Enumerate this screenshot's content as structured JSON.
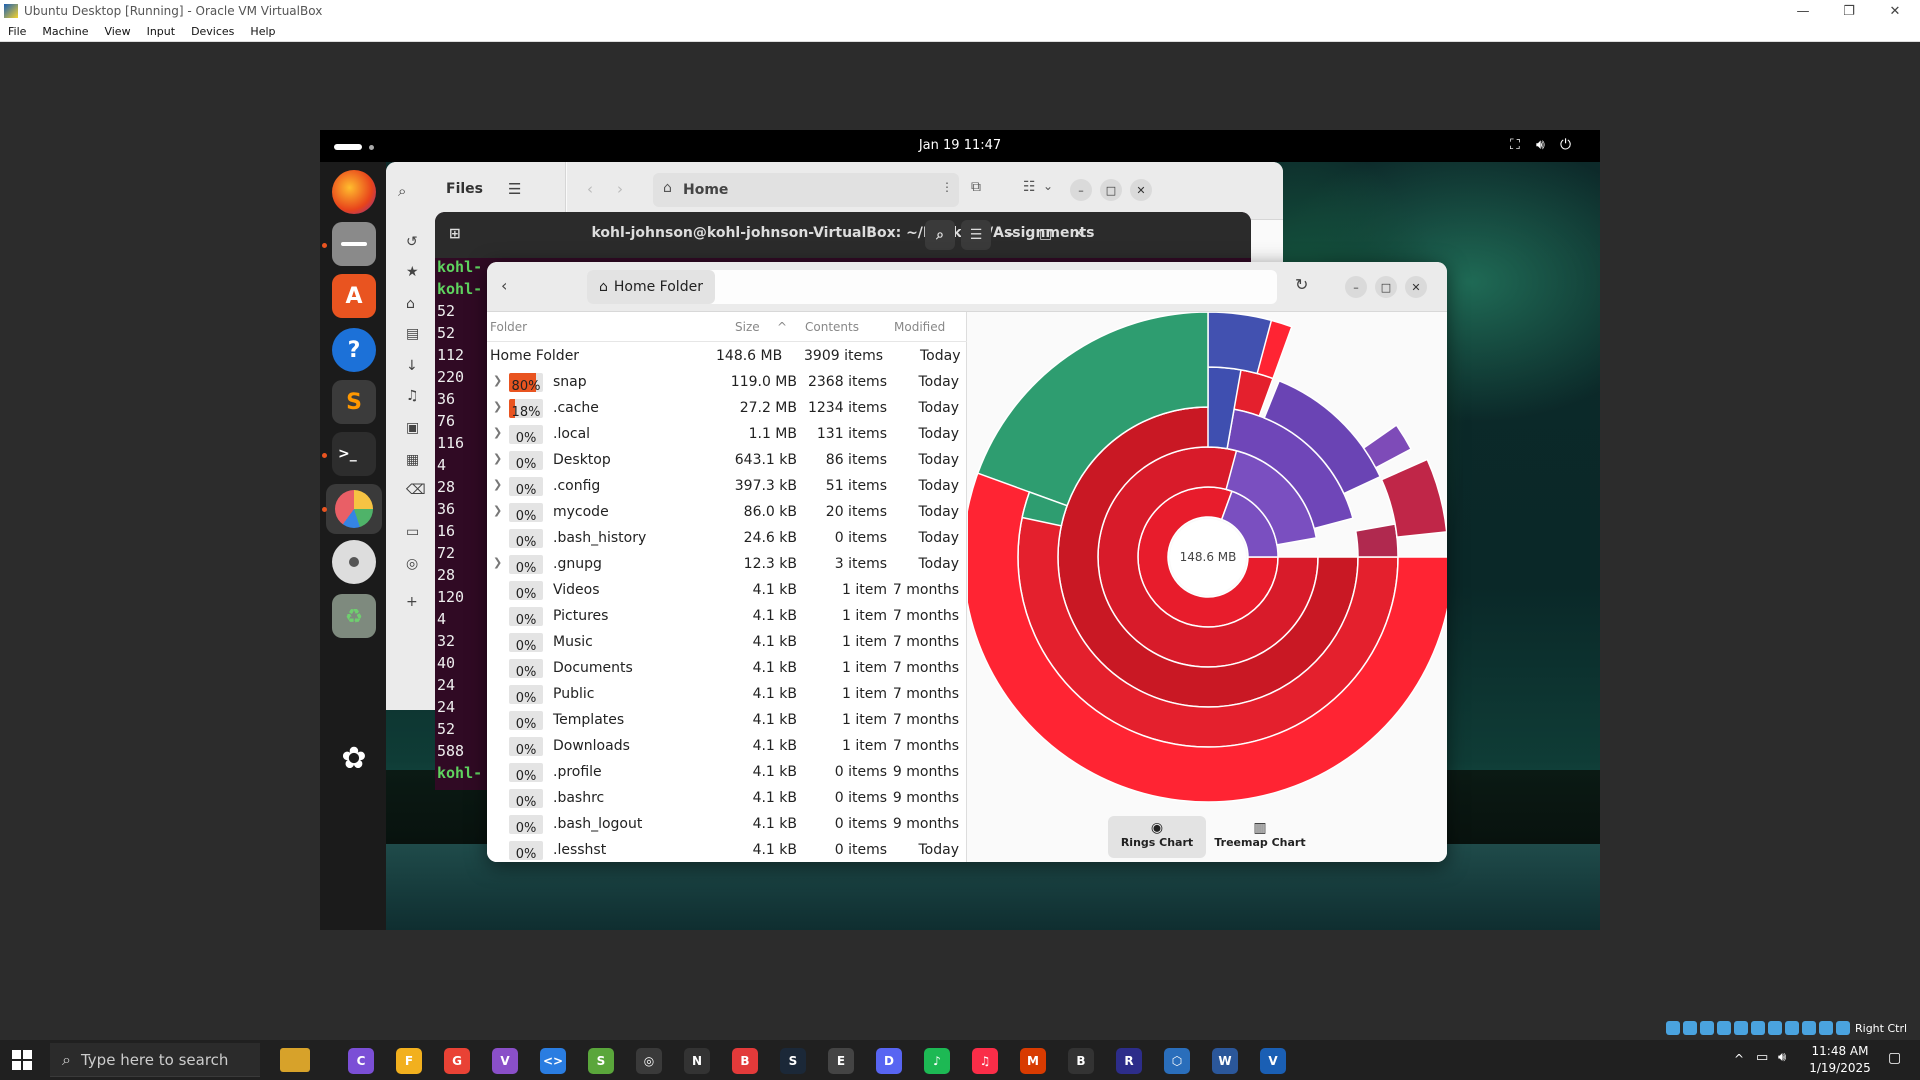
{
  "host": {
    "title": "Ubuntu Desktop [Running] - Oracle VM VirtualBox",
    "menu": [
      "File",
      "Machine",
      "View",
      "Input",
      "Devices",
      "Help"
    ],
    "host_key": "Right Ctrl"
  },
  "gnome": {
    "clock": "Jan 19  11:47"
  },
  "files_window": {
    "title": "Files",
    "location": "Home"
  },
  "terminal": {
    "title": "kohl-johnson@kohl-johnson-VirtualBox: ~/Desktop/Assignments",
    "prompt_fragment": "kohl-",
    "lines": [
      "kohl-",
      "kohl-",
      "52",
      "52",
      "112",
      "220",
      "36",
      "76",
      "116",
      "4",
      "28",
      "36",
      "16",
      "72",
      "28",
      "120",
      "4",
      "32",
      "40",
      "24",
      "24",
      "52",
      "588",
      "kohl-"
    ]
  },
  "baobab": {
    "location": "Home Folder",
    "columns": {
      "folder": "Folder",
      "size": "Size",
      "contents": "Contents",
      "modified": "Modified"
    },
    "root": {
      "name": "Home Folder",
      "size": "148.6 MB",
      "contents": "3909 items",
      "modified": "Today"
    },
    "rows": [
      {
        "pct": "80%",
        "fill": 80,
        "expand": true,
        "name": "snap",
        "size": "119.0 MB",
        "contents": "2368 items",
        "modified": "Today"
      },
      {
        "pct": "18%",
        "fill": 18,
        "expand": true,
        "name": ".cache",
        "size": "27.2 MB",
        "contents": "1234 items",
        "modified": "Today"
      },
      {
        "pct": "0%",
        "fill": 0,
        "expand": true,
        "name": ".local",
        "size": "1.1 MB",
        "contents": "131 items",
        "modified": "Today"
      },
      {
        "pct": "0%",
        "fill": 0,
        "expand": true,
        "name": "Desktop",
        "size": "643.1 kB",
        "contents": "86 items",
        "modified": "Today"
      },
      {
        "pct": "0%",
        "fill": 0,
        "expand": true,
        "name": ".config",
        "size": "397.3 kB",
        "contents": "51 items",
        "modified": "Today"
      },
      {
        "pct": "0%",
        "fill": 0,
        "expand": true,
        "name": "mycode",
        "size": "86.0 kB",
        "contents": "20 items",
        "modified": "Today"
      },
      {
        "pct": "0%",
        "fill": 0,
        "expand": false,
        "name": ".bash_history",
        "size": "24.6 kB",
        "contents": "0 items",
        "modified": "Today"
      },
      {
        "pct": "0%",
        "fill": 0,
        "expand": true,
        "name": ".gnupg",
        "size": "12.3 kB",
        "contents": "3 items",
        "modified": "Today"
      },
      {
        "pct": "0%",
        "fill": 0,
        "expand": false,
        "name": "Videos",
        "size": "4.1 kB",
        "contents": "1 item",
        "modified": "7 months"
      },
      {
        "pct": "0%",
        "fill": 0,
        "expand": false,
        "name": "Pictures",
        "size": "4.1 kB",
        "contents": "1 item",
        "modified": "7 months"
      },
      {
        "pct": "0%",
        "fill": 0,
        "expand": false,
        "name": "Music",
        "size": "4.1 kB",
        "contents": "1 item",
        "modified": "7 months"
      },
      {
        "pct": "0%",
        "fill": 0,
        "expand": false,
        "name": "Documents",
        "size": "4.1 kB",
        "contents": "1 item",
        "modified": "7 months"
      },
      {
        "pct": "0%",
        "fill": 0,
        "expand": false,
        "name": "Public",
        "size": "4.1 kB",
        "contents": "1 item",
        "modified": "7 months"
      },
      {
        "pct": "0%",
        "fill": 0,
        "expand": false,
        "name": "Templates",
        "size": "4.1 kB",
        "contents": "1 item",
        "modified": "7 months"
      },
      {
        "pct": "0%",
        "fill": 0,
        "expand": false,
        "name": "Downloads",
        "size": "4.1 kB",
        "contents": "1 item",
        "modified": "7 months"
      },
      {
        "pct": "0%",
        "fill": 0,
        "expand": false,
        "name": ".profile",
        "size": "4.1 kB",
        "contents": "0 items",
        "modified": "9 months"
      },
      {
        "pct": "0%",
        "fill": 0,
        "expand": false,
        "name": ".bashrc",
        "size": "4.1 kB",
        "contents": "0 items",
        "modified": "9 months"
      },
      {
        "pct": "0%",
        "fill": 0,
        "expand": false,
        "name": ".bash_logout",
        "size": "4.1 kB",
        "contents": "0 items",
        "modified": "9 months"
      },
      {
        "pct": "0%",
        "fill": 0,
        "expand": false,
        "name": ".lesshst",
        "size": "4.1 kB",
        "contents": "0 items",
        "modified": "Today"
      }
    ],
    "chart_center_label": "148.6 MB",
    "chart_tabs": [
      "Rings Chart",
      "Treemap Chart"
    ]
  },
  "taskbar": {
    "search_placeholder": "Type here to search",
    "time": "11:48 AM",
    "date": "1/19/2025",
    "apps": [
      "copilot",
      "explorer",
      "chrome",
      "visual-studio",
      "vscode",
      "sublime-like",
      "chatgpt",
      "notion",
      "brave",
      "steam",
      "epic",
      "discord",
      "spotify",
      "apple-music",
      "m365",
      "bar",
      "r",
      "virtualbox-cube",
      "word",
      "virtualbox"
    ]
  }
}
